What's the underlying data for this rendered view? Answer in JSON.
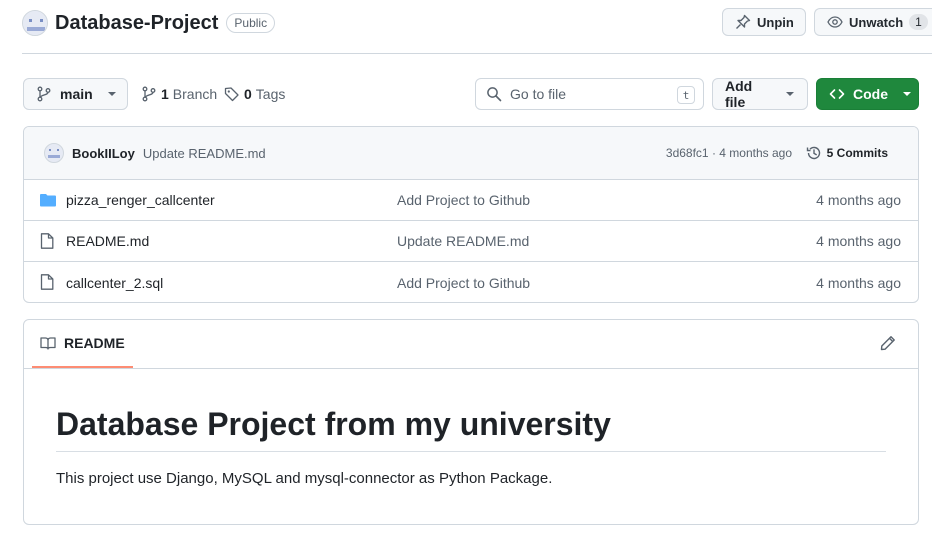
{
  "header": {
    "repo_name": "Database-Project",
    "visibility": "Public",
    "unpin_label": "Unpin",
    "watch_label": "Unwatch",
    "watch_count": "1"
  },
  "toolbar": {
    "branch": "main",
    "branch_count": "1",
    "branch_word": "Branch",
    "tag_count": "0",
    "tag_word": "Tags",
    "goto_placeholder": "Go to file",
    "goto_shortcut": "t",
    "add_file_label": "Add file",
    "code_label": "Code"
  },
  "commit": {
    "author": "BookIILoy",
    "message": "Update README.md",
    "sha_and_time": "3d68fc1 · 4 months ago",
    "commits_label": "5 Commits"
  },
  "files": [
    {
      "type": "folder",
      "name": "pizza_renger_callcenter",
      "message": "Add Project to Github",
      "date": "4 months ago"
    },
    {
      "type": "file",
      "name": "README.md",
      "message": "Update README.md",
      "date": "4 months ago"
    },
    {
      "type": "file",
      "name": "callcenter_2.sql",
      "message": "Add Project to Github",
      "date": "4 months ago"
    }
  ],
  "readme": {
    "tab_label": "README",
    "heading": "Database Project from my university",
    "paragraph": "This project use Django, MySQL and mysql-connector as Python Package."
  },
  "colors": {
    "accent_green": "#1f883d",
    "folder_blue": "#54aeff",
    "tab_underline": "#fd8c73"
  }
}
